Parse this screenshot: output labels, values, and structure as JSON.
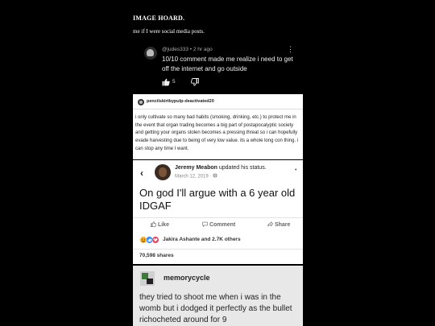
{
  "header": {
    "title": "IMAGE HOARD.",
    "caption": "me if I were social media posts."
  },
  "youtube_comment": {
    "username": "@judes333",
    "time": "2 hr ago",
    "separator": "•",
    "text": "10/10 comment made me realize i need to get off the internet and go outside",
    "likes": "5"
  },
  "tumblr_post": {
    "username": "pencilskirtbypulp-deactivated20",
    "body": "i only cultivate so many bad habits (smoking, drinking, etc.) to protect me in the event that organ trading becomes a big part of postapocalyptic society and getting your organs stolen becomes a pressing threat so i can hopefully evade harvesting due to being of very low value. its a whole long con thing. i can stop any time I want."
  },
  "facebook_post": {
    "name": "Jeremy Meabon",
    "action": "updated his status.",
    "date": "March 12, 2019 ·",
    "text": "On god I'll argue with a 6 year old IDGAF",
    "like_label": "Like",
    "comment_label": "Comment",
    "share_label": "Share",
    "reactions_text": "Jakira Ashante and 2.7K others",
    "shares_text": "70,598 shares"
  },
  "memorycycle_post": {
    "username": "memorycycle",
    "body": "they tried to shoot me when i was in the womb but i dodged it perfectly as the bullet richocheted around for 9"
  },
  "colors": {
    "background": "#000000",
    "fb_blue": "#1877f2",
    "fb_like_blue": "#2d88ff",
    "fb_heart_red": "#f33e58"
  }
}
